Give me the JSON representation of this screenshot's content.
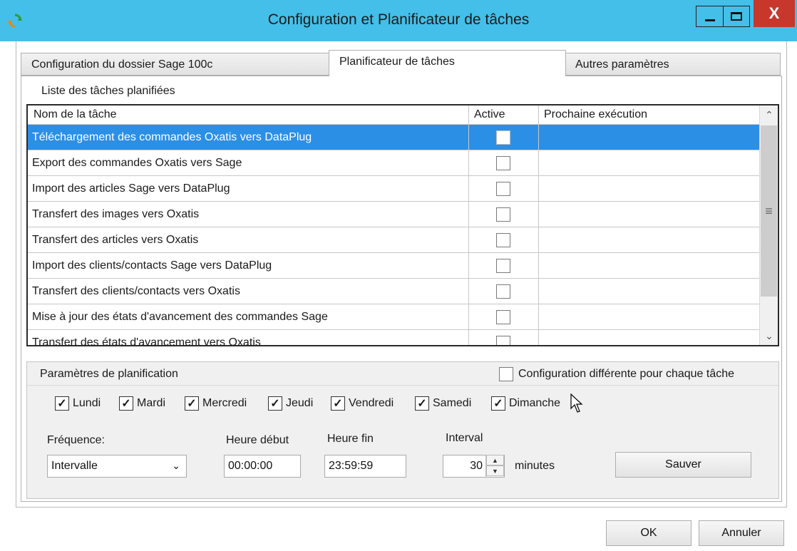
{
  "window": {
    "title": "Configuration et Planificateur de tâches",
    "minimize_symbol": "_",
    "close_symbol": "X",
    "app_icon": "refresh-sync-icon"
  },
  "tabs": [
    {
      "label": "Configuration du dossier Sage 100c",
      "active": false
    },
    {
      "label": "Planificateur de tâches",
      "active": true
    },
    {
      "label": "Autres paramètres",
      "active": false
    }
  ],
  "task_list": {
    "section_label": "Liste des tâches planifiées",
    "columns": {
      "name": "Nom de la tâche",
      "active": "Active",
      "next_run": "Prochaine exécution"
    },
    "rows": [
      {
        "name": "Téléchargement des commandes Oxatis vers DataPlug",
        "active": false,
        "next_run": "",
        "selected": true
      },
      {
        "name": "Export des commandes Oxatis vers Sage",
        "active": false,
        "next_run": "",
        "selected": false
      },
      {
        "name": "Import des articles Sage vers DataPlug",
        "active": false,
        "next_run": "",
        "selected": false
      },
      {
        "name": "Transfert des images vers Oxatis",
        "active": false,
        "next_run": "",
        "selected": false
      },
      {
        "name": "Transfert des articles vers Oxatis",
        "active": false,
        "next_run": "",
        "selected": false
      },
      {
        "name": "Import des clients/contacts Sage vers DataPlug",
        "active": false,
        "next_run": "",
        "selected": false
      },
      {
        "name": "Transfert des clients/contacts vers Oxatis",
        "active": false,
        "next_run": "",
        "selected": false
      },
      {
        "name": "Mise à jour des états d'avancement des commandes Sage",
        "active": false,
        "next_run": "",
        "selected": false
      },
      {
        "name": "Transfert des états d'avancement vers Oxatis",
        "active": false,
        "next_run": "",
        "selected": false
      }
    ]
  },
  "params": {
    "title": "Paramètres de planification",
    "different_config_label": "Configuration différente pour chaque tâche",
    "different_config_checked": false,
    "days": [
      {
        "label": "Lundi",
        "checked": true
      },
      {
        "label": "Mardi",
        "checked": true
      },
      {
        "label": "Mercredi",
        "checked": true
      },
      {
        "label": "Jeudi",
        "checked": true
      },
      {
        "label": "Vendredi",
        "checked": true
      },
      {
        "label": "Samedi",
        "checked": true
      },
      {
        "label": "Dimanche",
        "checked": true
      }
    ],
    "frequency_label": "Fréquence:",
    "frequency_value": "Intervalle",
    "start_label": "Heure début",
    "start_value": "00:00:00",
    "end_label": "Heure fin",
    "end_value": "23:59:59",
    "interval_label": "Interval",
    "interval_value": "30",
    "interval_unit": "minutes",
    "save_label": "Sauver"
  },
  "footer": {
    "ok_label": "OK",
    "cancel_label": "Annuler"
  },
  "colors": {
    "titlebar": "#43bfe9",
    "selection": "#2c8fe6",
    "close_button": "#c7372c"
  }
}
